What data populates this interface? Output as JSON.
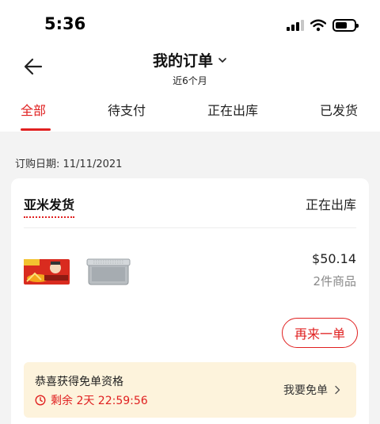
{
  "status_bar": {
    "time": "5:36"
  },
  "header": {
    "title": "我的订单",
    "subtitle": "近6个月"
  },
  "tabs": [
    {
      "label": "全部",
      "active": true
    },
    {
      "label": "待支付",
      "active": false
    },
    {
      "label": "正在出库",
      "active": false
    },
    {
      "label": "已发货",
      "active": false
    }
  ],
  "order": {
    "date_label": "订购日期: 11/11/2021",
    "shipper": "亚米发货",
    "status": "正在出库",
    "price": "$50.14",
    "item_count": "2件商品",
    "reorder_label": "再来一单",
    "promo": {
      "title": "恭喜获得免单资格",
      "timer": "剩余 2天 22:59:56",
      "action": "我要免单"
    }
  },
  "colors": {
    "accent": "#e02020",
    "promo_bg": "#fdf3dc"
  },
  "icons": [
    "back-arrow-icon",
    "chevron-down-icon",
    "clock-icon",
    "chevron-right-icon",
    "signal-icon",
    "wifi-icon",
    "battery-icon"
  ]
}
